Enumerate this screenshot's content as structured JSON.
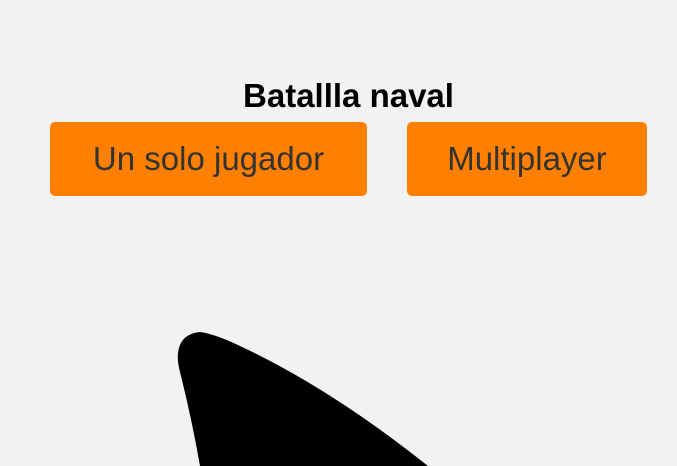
{
  "title": "Batallla naval",
  "buttons": {
    "single_player_label": "Un solo jugador",
    "multiplayer_label": "Multiplayer"
  },
  "colors": {
    "background": "#f2f2f2",
    "button_bg": "#ff7f00",
    "button_text": "#333333",
    "shape": "#000000"
  }
}
